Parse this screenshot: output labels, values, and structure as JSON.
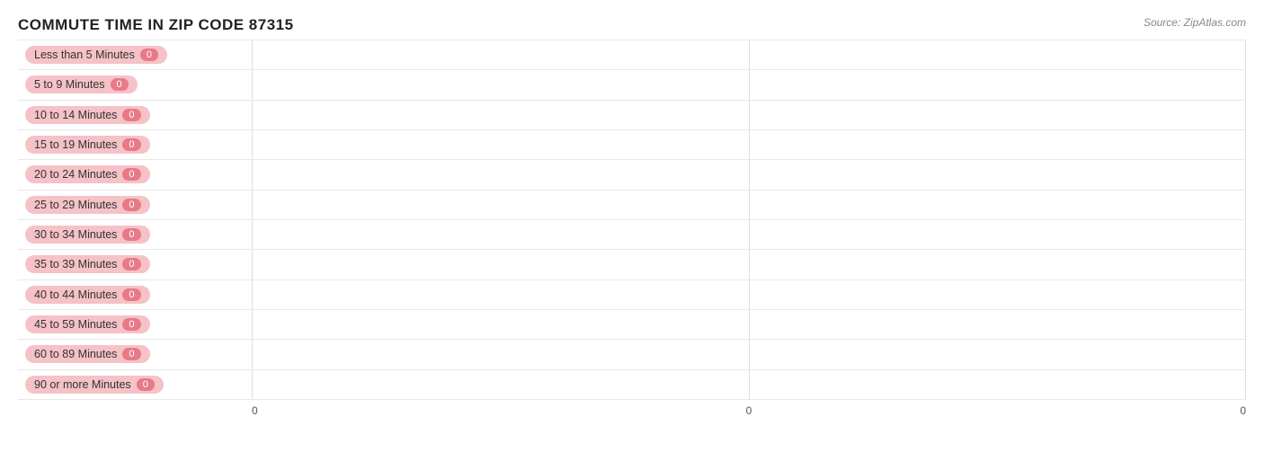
{
  "title": "COMMUTE TIME IN ZIP CODE 87315",
  "source": "Source: ZipAtlas.com",
  "rows": [
    {
      "label": "Less than 5 Minutes",
      "value": 0
    },
    {
      "label": "5 to 9 Minutes",
      "value": 0
    },
    {
      "label": "10 to 14 Minutes",
      "value": 0
    },
    {
      "label": "15 to 19 Minutes",
      "value": 0
    },
    {
      "label": "20 to 24 Minutes",
      "value": 0
    },
    {
      "label": "25 to 29 Minutes",
      "value": 0
    },
    {
      "label": "30 to 34 Minutes",
      "value": 0
    },
    {
      "label": "35 to 39 Minutes",
      "value": 0
    },
    {
      "label": "40 to 44 Minutes",
      "value": 0
    },
    {
      "label": "45 to 59 Minutes",
      "value": 0
    },
    {
      "label": "60 to 89 Minutes",
      "value": 0
    },
    {
      "label": "90 or more Minutes",
      "value": 0
    }
  ],
  "xAxis": {
    "labels": [
      "0",
      "0",
      "0"
    ]
  },
  "colors": {
    "pillBg": "#f5c2c7",
    "badgeBg": "#e87a87",
    "barFill": "#e87a87"
  }
}
